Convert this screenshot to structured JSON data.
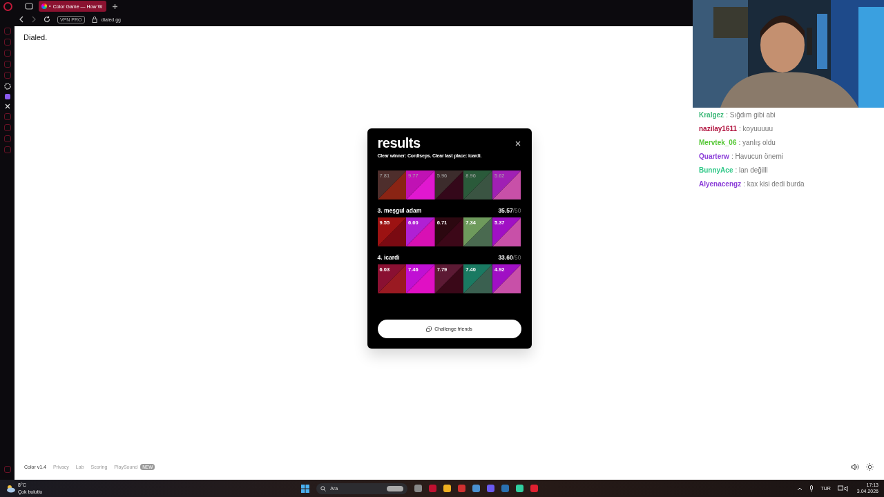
{
  "browser": {
    "tab_title": "Color Game — How W",
    "address": "dialed.gg",
    "vpn_badge": "VPN PRO"
  },
  "page": {
    "logo": "Dialed.",
    "results": {
      "title": "results",
      "summary": "Clear winner: Cordiseps. Clear last place: icardi.",
      "players": [
        {
          "faded": true,
          "swatches": [
            {
              "value": "7.81",
              "color": "#8a2414",
              "target": {
                "color": "#4e2e2c"
              }
            },
            {
              "value": "9.77",
              "color": "#e018d0",
              "target": {
                "color": "#c012b4"
              }
            },
            {
              "value": "5.96",
              "color": "#34081a",
              "target": {
                "color": "#3c2c2c"
              }
            },
            {
              "value": "8.96",
              "color": "#3a5442",
              "target": {
                "color": "#2a5a3a"
              }
            },
            {
              "value": "5.62",
              "color": "#c850a8",
              "target": {
                "color": "#a020b4"
              }
            }
          ]
        },
        {
          "rank_name": "3. meşgul adam",
          "score": "35.57",
          "max": "/50",
          "faded": false,
          "swatches": [
            {
              "value": "9.55",
              "color": "#7a0a12",
              "target": {
                "color": "#9c1212"
              }
            },
            {
              "value": "6.60",
              "color": "#d810b4",
              "target": {
                "color": "#b020d4"
              }
            },
            {
              "value": "6.71",
              "color": "#3c0818",
              "target": {
                "color": "#2c0810"
              }
            },
            {
              "value": "7.34",
              "color": "#4a6a50",
              "target": {
                "color": "#6e9a5c"
              }
            },
            {
              "value": "5.37",
              "color": "#c850a8",
              "target": {
                "color": "#a010c4"
              }
            }
          ]
        },
        {
          "rank_name": "4. icardi",
          "score": "33.60",
          "max": "/50",
          "faded": false,
          "swatches": [
            {
              "value": "6.03",
              "color": "#9a1a22",
              "target": {
                "color": "#8a1032"
              }
            },
            {
              "value": "7.46",
              "color": "#e010c4",
              "target": {
                "color": "#c010d4"
              }
            },
            {
              "value": "7.79",
              "color": "#3a0818",
              "target": {
                "color": "#5c1a34"
              }
            },
            {
              "value": "7.40",
              "color": "#3a6050",
              "target": {
                "color": "#1a7a62"
              }
            },
            {
              "value": "4.92",
              "color": "#c850a8",
              "target": {
                "color": "#a010c4"
              }
            }
          ]
        }
      ],
      "button": "Challenge friends"
    },
    "footer_links": [
      "Color v1.4",
      "Privacy",
      "Lab",
      "Scoring",
      "PlaySound"
    ],
    "footer_badge": "NEW"
  },
  "chat": [
    {
      "user": "Kralgez",
      "text": ": Sığdım gibi abi",
      "color": "#3cb878"
    },
    {
      "user": "nazilay1611",
      "text": ": koyuuuuu",
      "color": "#b0103c"
    },
    {
      "user": "Mervtek_06",
      "text": ": yanlış oldu",
      "color": "#58c838"
    },
    {
      "user": "Quarterw",
      "text": ": Havucun önemi",
      "color": "#8a3cd8"
    },
    {
      "user": "BunnyAce",
      "text": ": lan değilll",
      "color": "#30c888"
    },
    {
      "user": "Alyenacengz",
      "text": ": kax kisi dedi burda",
      "color": "#8a3cd8"
    }
  ],
  "taskbar": {
    "temperature": "8°C",
    "weather": "Çok bulutlu",
    "search_placeholder": "Ara",
    "language": "TUR",
    "time": "17:13",
    "date": "3.04.2026"
  }
}
